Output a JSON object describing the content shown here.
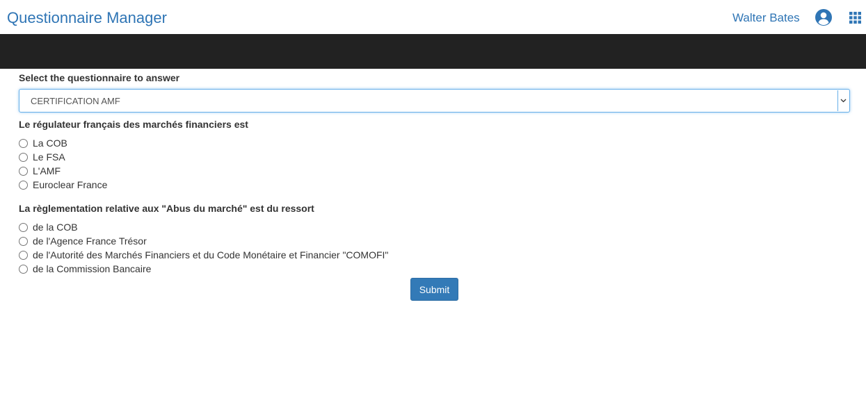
{
  "header": {
    "app_title": "Questionnaire Manager",
    "user_name": "Walter Bates",
    "user_icon": "account-circle-icon",
    "apps_icon": "apps-grid-icon"
  },
  "colors": {
    "accent": "#2f75b5",
    "dark_bar": "#222222",
    "button": "#337ab7",
    "focus_border": "#66afe9"
  },
  "form": {
    "select_label": "Select the questionnaire to answer",
    "selected_questionnaire": "CERTIFICATION AMF",
    "questions": [
      {
        "title": "Le régulateur français des marchés financiers est",
        "options": [
          "La COB",
          "Le FSA",
          "L'AMF",
          "Euroclear France"
        ]
      },
      {
        "title": "La règlementation relative aux \"Abus du marché\" est du ressort",
        "options": [
          "de la COB",
          "de l'Agence France Trésor",
          "de l'Autorité des Marchés Financiers et du Code Monétaire et Financier \"COMOFI\"",
          "de la Commission Bancaire"
        ]
      }
    ],
    "submit_label": "Submit"
  }
}
